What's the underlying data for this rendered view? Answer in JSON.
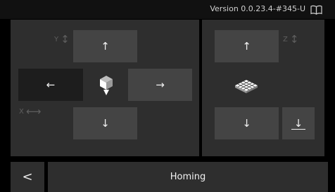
{
  "status": {
    "version": "Version 0.0.23.4-#345-U",
    "icon": "book-icon"
  },
  "xy": {
    "y_axis_label": "Y",
    "x_axis_label": "X",
    "up": "↑",
    "down": "↓",
    "left": "←",
    "right": "→",
    "home_icon": "home-xy-icon"
  },
  "z": {
    "z_axis_label": "Z",
    "up": "↑",
    "down": "↓",
    "home_icon": "bed-icon",
    "home_down": "↓"
  },
  "footer": {
    "back": "<",
    "title": "Homing"
  },
  "colors": {
    "background": "#000000",
    "panel": "#2e2e2e",
    "button": "#444444",
    "button_dark": "#1d1d1d",
    "axis_label": "#5e5e5e"
  }
}
